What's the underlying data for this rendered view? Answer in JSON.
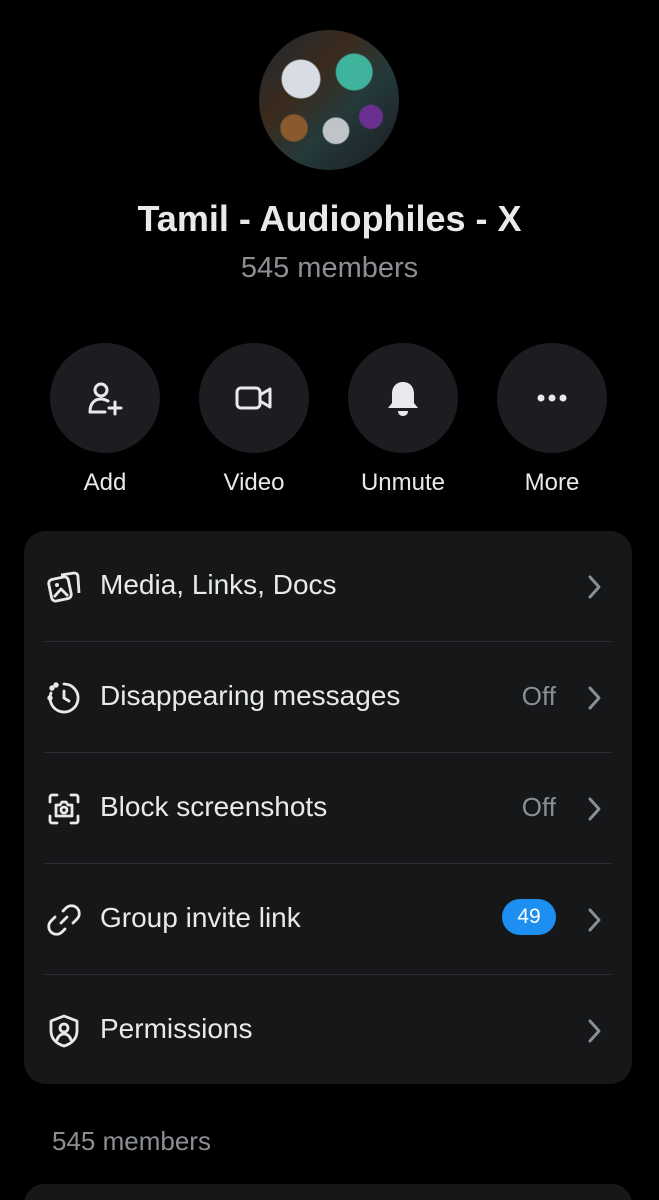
{
  "group": {
    "name": "Tamil - Audiophiles - X",
    "member_count": "545 members"
  },
  "actions": [
    {
      "label": "Add",
      "icon": "add-person-icon"
    },
    {
      "label": "Video",
      "icon": "video-camera-icon"
    },
    {
      "label": "Unmute",
      "icon": "bell-icon"
    },
    {
      "label": "More",
      "icon": "more-dots-icon"
    }
  ],
  "settings": [
    {
      "label": "Media, Links, Docs",
      "icon": "media-icon",
      "value": ""
    },
    {
      "label": "Disappearing messages",
      "icon": "timer-icon",
      "value": "Off"
    },
    {
      "label": "Block screenshots",
      "icon": "screenshot-camera-icon",
      "value": "Off"
    },
    {
      "label": "Group invite link",
      "icon": "link-icon",
      "badge": "49"
    },
    {
      "label": "Permissions",
      "icon": "shield-user-icon",
      "value": ""
    }
  ],
  "members_section": {
    "label": "545 members"
  },
  "colors": {
    "background": "#000000",
    "card": "#161719",
    "badge": "#1d8ff0",
    "muted_text": "#8b8f94"
  }
}
